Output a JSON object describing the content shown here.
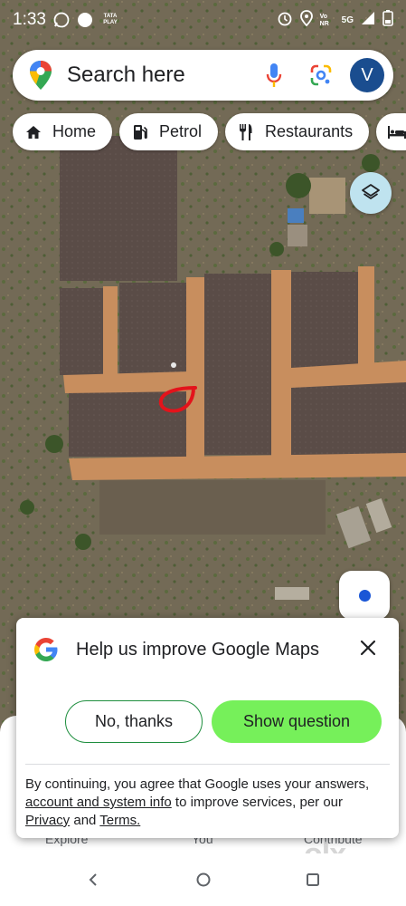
{
  "status_bar": {
    "time": "1:33",
    "carrier_badge": "TATA PLAY",
    "volte_label": "Vo NR",
    "network": "5G"
  },
  "search": {
    "placeholder": "Search here",
    "avatar_letter": "V"
  },
  "chips": [
    {
      "label": "Home",
      "icon": "home-icon"
    },
    {
      "label": "Petrol",
      "icon": "fuel-pump-icon"
    },
    {
      "label": "Restaurants",
      "icon": "restaurant-icon"
    },
    {
      "label": "",
      "icon": "hotel-icon"
    }
  ],
  "bottom_nav": {
    "items": [
      "Explore",
      "You",
      "Contribute"
    ]
  },
  "survey_dialog": {
    "title": "Help us improve Google Maps",
    "no_button": "No, thanks",
    "show_button": "Show question",
    "footer_prefix": "By continuing, you agree that Google uses your answers, ",
    "footer_link_account": "account and system info",
    "footer_middle": " to improve services, per our ",
    "footer_link_privacy": "Privacy",
    "footer_and": " and ",
    "footer_link_terms": "Terms."
  },
  "watermark": "olx",
  "colors": {
    "show_button_bg": "#76f05a",
    "no_button_border": "#1e8e3e",
    "avatar_bg": "#1a4d8f",
    "location_dot": "#1a56d6",
    "marker_red": "#e3131b"
  }
}
